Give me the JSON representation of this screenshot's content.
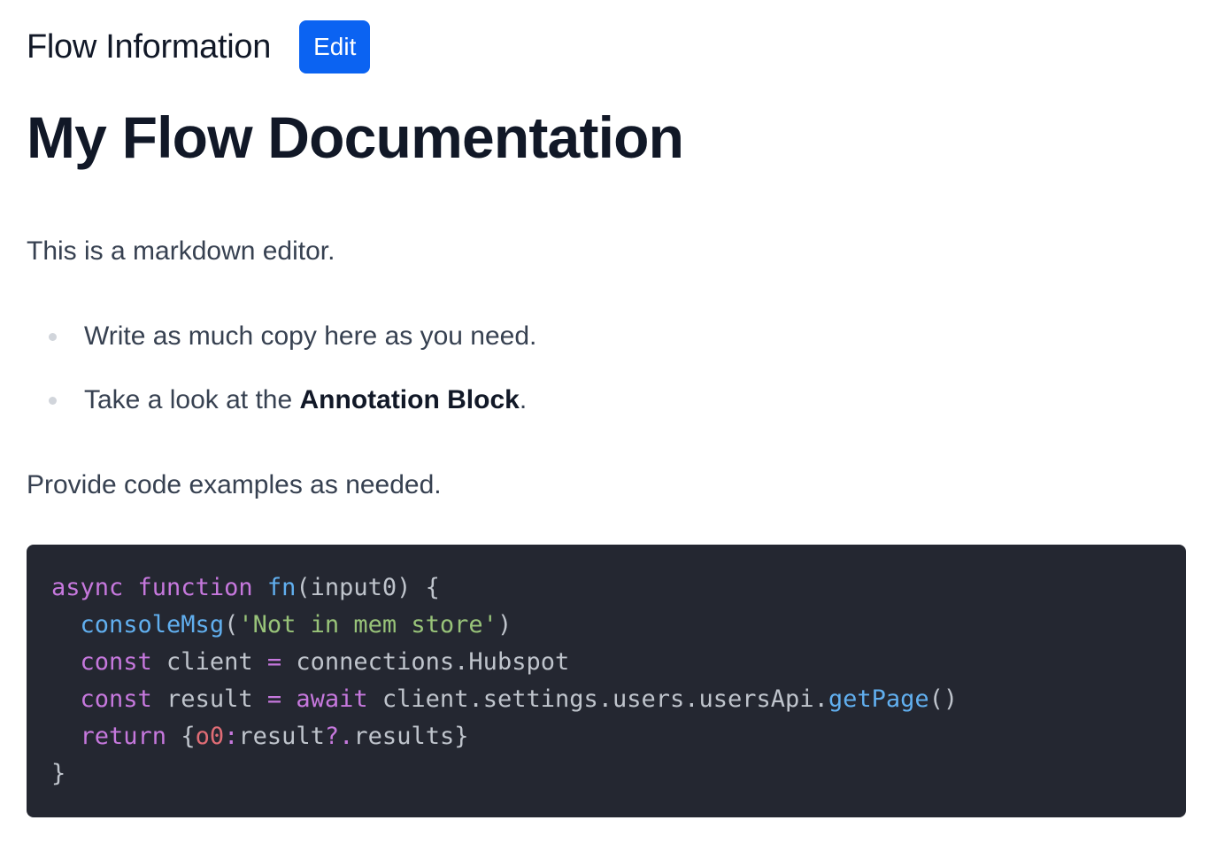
{
  "header": {
    "title": "Flow Information",
    "edit_label": "Edit"
  },
  "document": {
    "title": "My Flow Documentation",
    "intro": "This is a markdown editor.",
    "bullets": [
      {
        "text": "Write as much copy here as you need."
      },
      {
        "prefix": "Take a look at the ",
        "bold": "Annotation Block",
        "suffix": "."
      }
    ],
    "outro": "Provide code examples as needed."
  },
  "code": {
    "language": "javascript",
    "lines": [
      [
        {
          "t": "async",
          "c": "kw"
        },
        {
          "t": " ",
          "c": "plain"
        },
        {
          "t": "function",
          "c": "kw"
        },
        {
          "t": " ",
          "c": "plain"
        },
        {
          "t": "fn",
          "c": "fn"
        },
        {
          "t": "(input0) {",
          "c": "plain"
        }
      ],
      [
        {
          "t": "  ",
          "c": "plain"
        },
        {
          "t": "consoleMsg",
          "c": "fn"
        },
        {
          "t": "(",
          "c": "plain"
        },
        {
          "t": "'Not in mem store'",
          "c": "str"
        },
        {
          "t": ")",
          "c": "plain"
        }
      ],
      [
        {
          "t": "  ",
          "c": "plain"
        },
        {
          "t": "const",
          "c": "kw"
        },
        {
          "t": " client ",
          "c": "plain"
        },
        {
          "t": "=",
          "c": "kw"
        },
        {
          "t": " connections.Hubspot",
          "c": "plain"
        }
      ],
      [
        {
          "t": "  ",
          "c": "plain"
        },
        {
          "t": "const",
          "c": "kw"
        },
        {
          "t": " result ",
          "c": "plain"
        },
        {
          "t": "=",
          "c": "kw"
        },
        {
          "t": " ",
          "c": "plain"
        },
        {
          "t": "await",
          "c": "kw"
        },
        {
          "t": " client.settings.users.usersApi.",
          "c": "plain"
        },
        {
          "t": "getPage",
          "c": "fn"
        },
        {
          "t": "()",
          "c": "plain"
        }
      ],
      [
        {
          "t": "  ",
          "c": "plain"
        },
        {
          "t": "return",
          "c": "kw"
        },
        {
          "t": " {",
          "c": "plain"
        },
        {
          "t": "o0",
          "c": "prop"
        },
        {
          "t": ":",
          "c": "kw"
        },
        {
          "t": "result",
          "c": "plain"
        },
        {
          "t": "?.",
          "c": "kw"
        },
        {
          "t": "results}",
          "c": "plain"
        }
      ],
      [
        {
          "t": "}",
          "c": "plain"
        }
      ]
    ]
  },
  "colors": {
    "accent": "#0b63f2",
    "code_background": "#242731",
    "heading": "#111827",
    "body_text": "#374151"
  }
}
